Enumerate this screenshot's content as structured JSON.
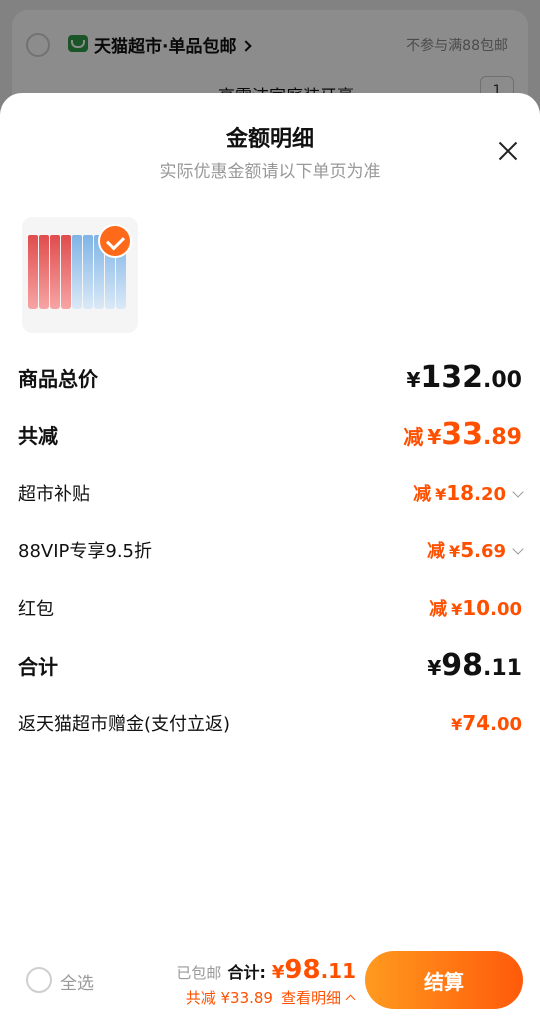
{
  "background": {
    "shop_name": "天猫超市·单品包邮",
    "shop_note": "不参与满88包邮",
    "product_title_partial": "高露洁家庭装牙膏",
    "qty": "1"
  },
  "sheet": {
    "title": "金额明细",
    "subtitle": "实际优惠金额请以下单页为准",
    "rows": [
      {
        "label": "商品总价",
        "prefix": "",
        "yen": "¥",
        "int": "132",
        "dec": ".00"
      },
      {
        "label": "共减",
        "prefix": "减",
        "yen": "¥",
        "int": "33",
        "dec": ".89"
      },
      {
        "label": "超市补贴",
        "prefix": "减",
        "yen": "¥",
        "int": "18",
        "dec": ".20"
      },
      {
        "label": "88VIP专享9.5折",
        "prefix": "减",
        "yen": "¥",
        "int": "5",
        "dec": ".69"
      },
      {
        "label": "红包",
        "prefix": "减",
        "yen": "¥",
        "int": "10",
        "dec": ".00"
      },
      {
        "label": "合计",
        "prefix": "",
        "yen": "¥",
        "int": "98",
        "dec": ".11"
      },
      {
        "label": "返天猫超市赠金(支付立返)",
        "prefix": "",
        "yen": "¥",
        "int": "74",
        "dec": ".00"
      }
    ]
  },
  "bottom_bar": {
    "select_all": "全选",
    "free_shipping": "已包邮",
    "total_label": "合计:",
    "total_yen": "¥",
    "total_int": "98",
    "total_dec": ".11",
    "saved_text": "共减 ¥33.89",
    "details_link": "查看明细",
    "checkout": "结算"
  },
  "colors": {
    "accent": "#ff5000",
    "checkout_gradient_start": "#ff9a1e",
    "checkout_gradient_end": "#ff5a0a"
  }
}
